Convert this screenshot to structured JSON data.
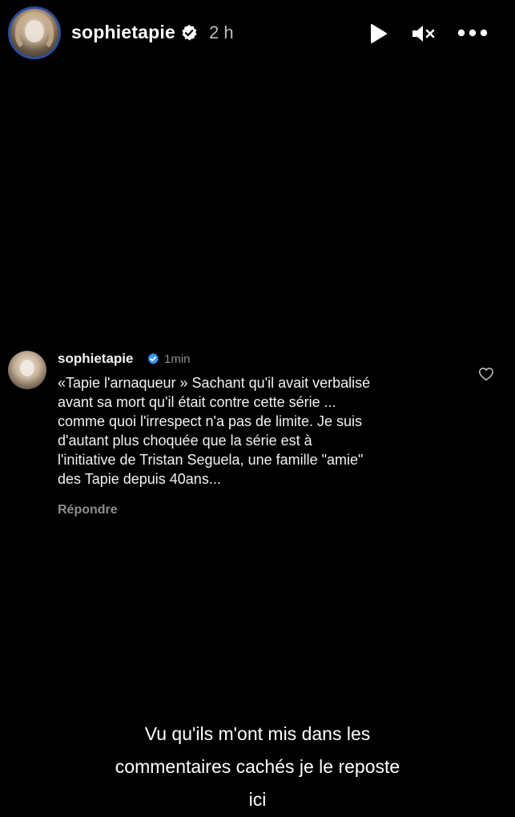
{
  "story": {
    "username": "sophietapie",
    "time_ago": "2 h",
    "icons": {
      "verified": "verified-badge-icon",
      "play": "play-icon",
      "mute": "speaker-muted-icon",
      "more": "more-horizontal-icon"
    }
  },
  "comment": {
    "username": "sophietapie",
    "time_ago": "1min",
    "lines": [
      "«Tapie l'arnaqueur » Sachant qu'il avait verbalisé",
      "avant sa mort qu'il était contre cette série ...",
      "comme quoi l'irrespect n'a pas de limite. Je suis",
      "d'autant plus choquée que la série est à",
      "l'initiative de Tristan Seguela,  une famille \"amie\"",
      "des Tapie depuis 40ans..."
    ],
    "reply_label": "Répondre",
    "icons": {
      "like": "heart-outline-icon"
    }
  },
  "caption": {
    "lines": [
      "Vu qu'ils m'ont mis dans les",
      "commentaires cachés je le reposte",
      "ici"
    ]
  },
  "colors": {
    "background": "#000000",
    "verified": "#3897f0",
    "avatar_ring": "#2d4c9b",
    "muted_text": "#8e8e8e"
  }
}
